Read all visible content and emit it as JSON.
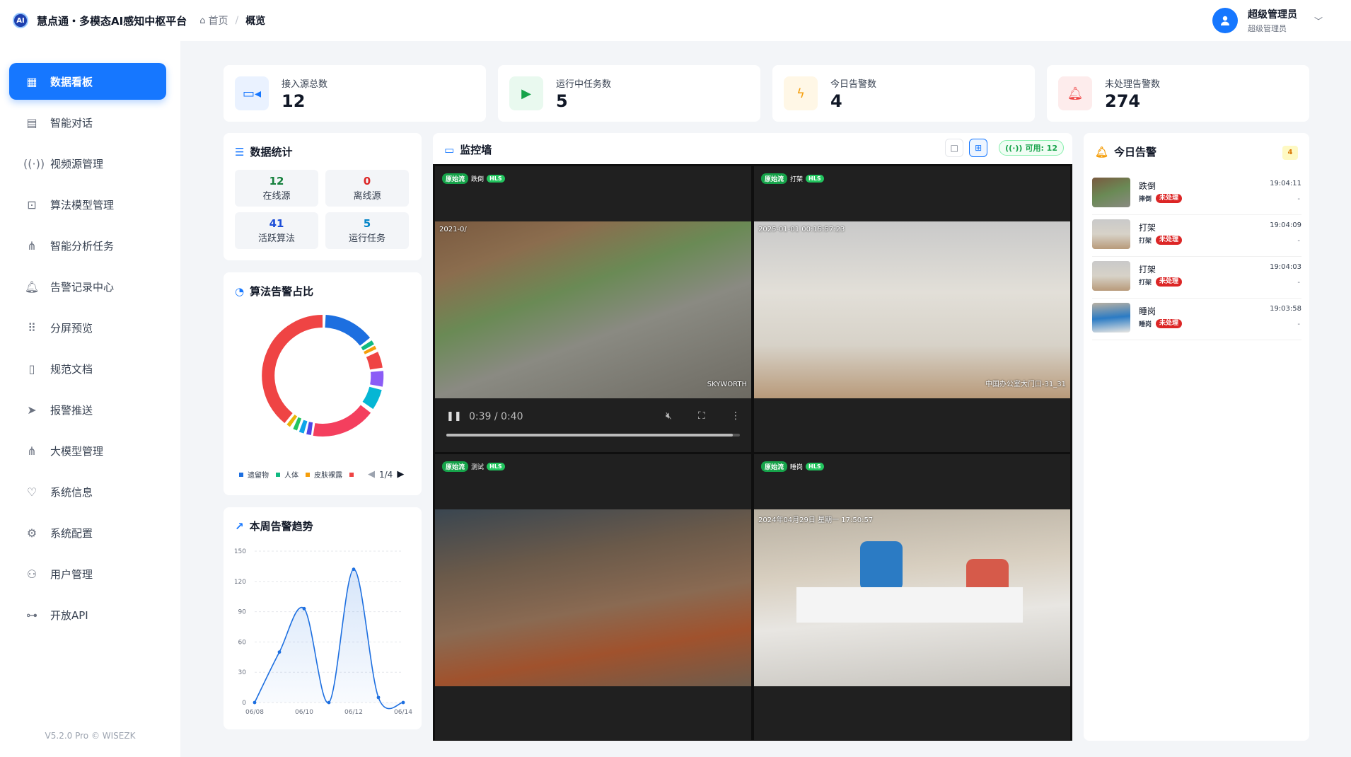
{
  "header": {
    "logo_text": "AI",
    "app_title": "慧点通・多模态AI感知中枢平台",
    "breadcrumb": [
      "首页",
      "概览"
    ],
    "user_name": "超级管理员",
    "user_role": "超级管理员"
  },
  "sidebar": {
    "items": [
      {
        "label": "数据看板",
        "icon": "dashboard-icon",
        "active": true
      },
      {
        "label": "智能对话",
        "icon": "chat-icon"
      },
      {
        "label": "视频源管理",
        "icon": "broadcast-icon"
      },
      {
        "label": "算法模型管理",
        "icon": "chip-icon"
      },
      {
        "label": "智能分析任务",
        "icon": "hierarchy-icon"
      },
      {
        "label": "告警记录中心",
        "icon": "bell-icon"
      },
      {
        "label": "分屏预览",
        "icon": "grid-icon"
      },
      {
        "label": "规范文档",
        "icon": "document-icon"
      },
      {
        "label": "报警推送",
        "icon": "send-icon"
      },
      {
        "label": "大模型管理",
        "icon": "network-icon"
      },
      {
        "label": "系统信息",
        "icon": "heartbeat-icon"
      },
      {
        "label": "系统配置",
        "icon": "gear-icon"
      },
      {
        "label": "用户管理",
        "icon": "users-icon"
      },
      {
        "label": "开放API",
        "icon": "key-icon"
      }
    ],
    "version": "V5.2.0 Pro © WISEZK"
  },
  "stats": [
    {
      "label": "接入源总数",
      "value": "12",
      "icon": "camera-icon",
      "color": "#1677ff",
      "bg": "#eaf2ff"
    },
    {
      "label": "运行中任务数",
      "value": "5",
      "icon": "play-icon",
      "color": "#16a34a",
      "bg": "#e9f9ef"
    },
    {
      "label": "今日告警数",
      "value": "4",
      "icon": "lightning-icon",
      "color": "#f59e0b",
      "bg": "#fff7e6"
    },
    {
      "label": "未处理告警数",
      "value": "274",
      "icon": "bell-icon",
      "color": "#ef4444",
      "bg": "#fdecec"
    }
  ],
  "data_stats": {
    "title": "数据统计",
    "items": [
      {
        "value": "12",
        "label": "在线源",
        "color": "#15803d"
      },
      {
        "value": "0",
        "label": "离线源",
        "color": "#dc2626"
      },
      {
        "value": "41",
        "label": "活跃算法",
        "color": "#1d4ed8"
      },
      {
        "value": "5",
        "label": "运行任务",
        "color": "#0284c7"
      }
    ]
  },
  "donut": {
    "title": "算法告警占比",
    "legend": [
      {
        "name": "遗留物",
        "color": "#1d6fe0"
      },
      {
        "name": "人体",
        "color": "#10b981"
      },
      {
        "name": "皮肤裸露",
        "color": "#f59e0b"
      },
      {
        "name": "",
        "color": "#ef4444"
      }
    ],
    "page": "1/4"
  },
  "chart_data": {
    "type": "line",
    "title": "本周告警趋势",
    "x": [
      "06/08",
      "06/09",
      "06/10",
      "06/11",
      "06/12",
      "06/13",
      "06/14"
    ],
    "x_ticks": [
      "06/08",
      "06/10",
      "06/12",
      "06/14"
    ],
    "values": [
      0,
      50,
      93,
      0,
      132,
      5,
      0
    ],
    "ylim": [
      0,
      150
    ],
    "yticks": [
      0,
      30,
      60,
      90,
      120,
      150
    ],
    "color": "#1d6fe0",
    "grid": true
  },
  "monitor": {
    "title": "监控墙",
    "available": "可用: 12",
    "cells": [
      {
        "raw": "原始流",
        "name": "跌倒",
        "hls": "HLS",
        "overlay": "2021-0/",
        "overlay2": "SKYWORTH"
      },
      {
        "raw": "原始流",
        "name": "打架",
        "hls": "HLS",
        "overlay": "2025-01-01 00:15:57:23",
        "overlay2": "中国办公室大门口-31_31"
      },
      {
        "raw": "原始流",
        "name": "测试",
        "hls": "HLS",
        "overlay": "",
        "overlay2": ""
      },
      {
        "raw": "原始流",
        "name": "睡岗",
        "hls": "HLS",
        "overlay": "2024年04月29日 星期一 17:50:57",
        "overlay2": ""
      }
    ],
    "video_time": "0:39 / 0:40",
    "video_progress": 0.975
  },
  "alerts": {
    "title": "今日告警",
    "count": "4",
    "items": [
      {
        "name": "跌倒",
        "type": "摔倒",
        "status": "未处理",
        "time": "19:04:11",
        "extra": "-"
      },
      {
        "name": "打架",
        "type": "打架",
        "status": "未处理",
        "time": "19:04:09",
        "extra": "-"
      },
      {
        "name": "打架",
        "type": "打架",
        "status": "未处理",
        "time": "19:04:03",
        "extra": "-"
      },
      {
        "name": "睡岗",
        "type": "睡岗",
        "status": "未处理",
        "time": "19:03:58",
        "extra": "-"
      }
    ]
  }
}
